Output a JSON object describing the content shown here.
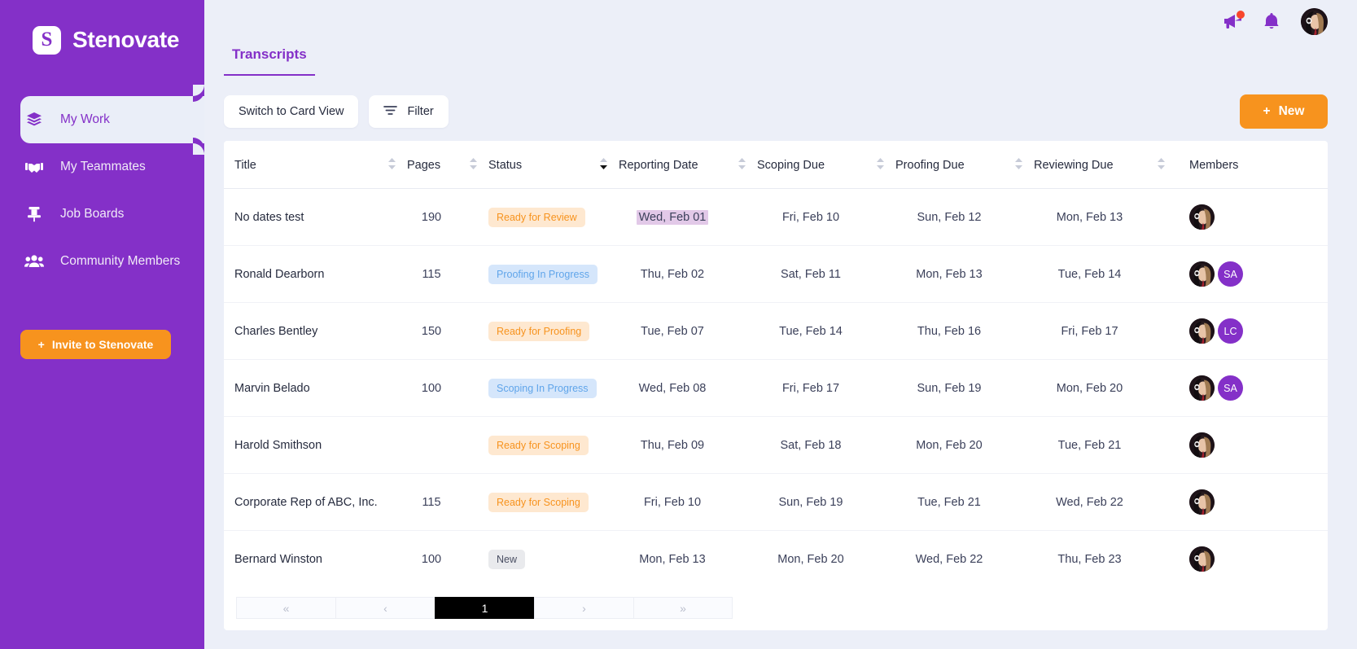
{
  "brand": {
    "name": "Stenovate",
    "logo_letter": "S"
  },
  "sidebar": {
    "items": [
      {
        "label": "My Work",
        "icon": "layers-icon",
        "active": true
      },
      {
        "label": "My Teammates",
        "icon": "handshake-icon",
        "active": false
      },
      {
        "label": "Job Boards",
        "icon": "pin-icon",
        "active": false
      },
      {
        "label": "Community Members",
        "icon": "users-icon",
        "active": false
      }
    ],
    "invite_button": "Invite to Stenovate"
  },
  "topbar": {
    "announce_icon": "megaphone-icon",
    "has_notification_dot": true,
    "bell_icon": "bell-icon",
    "avatar_icon": "user-avatar"
  },
  "tabs": [
    {
      "label": "Transcripts",
      "active": true
    }
  ],
  "toolbar": {
    "switch_view_label": "Switch to Card View",
    "filter_label": "Filter",
    "new_label": "New",
    "new_plus": "+"
  },
  "table": {
    "columns": [
      {
        "label": "Title",
        "sortable": true
      },
      {
        "label": "Pages",
        "sortable": true
      },
      {
        "label": "Status",
        "sortable": true,
        "sort_state": "desc"
      },
      {
        "label": "Reporting Date",
        "sortable": true
      },
      {
        "label": "Scoping Due",
        "sortable": true
      },
      {
        "label": "Proofing Due",
        "sortable": true
      },
      {
        "label": "Reviewing Due",
        "sortable": true
      },
      {
        "label": "Members",
        "sortable": false
      }
    ],
    "rows": [
      {
        "title": "No dates test",
        "pages": "190",
        "status": "Ready for Review",
        "status_tone": "orange",
        "reporting_date": "Wed, Feb 01",
        "reporting_highlighted": true,
        "scoping_due": "Fri, Feb 10",
        "proofing_due": "Sun, Feb 12",
        "reviewing_due": "Mon, Feb 13",
        "members": []
      },
      {
        "title": "Ronald Dearborn",
        "pages": "115",
        "status": "Proofing In Progress",
        "status_tone": "blue",
        "reporting_date": "Thu, Feb 02",
        "reporting_highlighted": false,
        "scoping_due": "Sat, Feb 11",
        "proofing_due": "Mon, Feb 13",
        "reviewing_due": "Tue, Feb 14",
        "members": [
          "SA"
        ]
      },
      {
        "title": "Charles Bentley",
        "pages": "150",
        "status": "Ready for Proofing",
        "status_tone": "orange",
        "reporting_date": "Tue, Feb 07",
        "reporting_highlighted": false,
        "scoping_due": "Tue, Feb 14",
        "proofing_due": "Thu, Feb 16",
        "reviewing_due": "Fri, Feb 17",
        "members": [
          "LC"
        ]
      },
      {
        "title": "Marvin Belado",
        "pages": "100",
        "status": "Scoping In Progress",
        "status_tone": "blue",
        "reporting_date": "Wed, Feb 08",
        "reporting_highlighted": false,
        "scoping_due": "Fri, Feb 17",
        "proofing_due": "Sun, Feb 19",
        "reviewing_due": "Mon, Feb 20",
        "members": [
          "SA"
        ]
      },
      {
        "title": "Harold Smithson",
        "pages": "",
        "status": "Ready for Scoping",
        "status_tone": "orange",
        "reporting_date": "Thu, Feb 09",
        "reporting_highlighted": false,
        "scoping_due": "Sat, Feb 18",
        "proofing_due": "Mon, Feb 20",
        "reviewing_due": "Tue, Feb 21",
        "members": []
      },
      {
        "title": "Corporate Rep of ABC, Inc.",
        "pages": "115",
        "status": "Ready for Scoping",
        "status_tone": "orange",
        "reporting_date": "Fri, Feb 10",
        "reporting_highlighted": false,
        "scoping_due": "Sun, Feb 19",
        "proofing_due": "Tue, Feb 21",
        "reviewing_due": "Wed, Feb 22",
        "members": []
      },
      {
        "title": "Bernard Winston",
        "pages": "100",
        "status": "New",
        "status_tone": "grey",
        "reporting_date": "Mon, Feb 13",
        "reporting_highlighted": false,
        "scoping_due": "Mon, Feb 20",
        "proofing_due": "Wed, Feb 22",
        "reviewing_due": "Thu, Feb 23",
        "members": []
      }
    ]
  },
  "pagination": {
    "first": "«",
    "prev": "‹",
    "next": "›",
    "last": "»",
    "current_page": "1"
  },
  "colors": {
    "brand_purple": "#8430c8",
    "accent_orange": "#f7931e",
    "page_bg": "#eceff8",
    "status_orange_bg": "#fee8d0",
    "status_orange_fg": "#f7931e",
    "status_blue_bg": "#d5e6fb",
    "status_blue_fg": "#60a5ea",
    "status_grey_bg": "#e9eaed",
    "highlight_lilac": "#e2c9e8",
    "pager_active": "#000000"
  }
}
